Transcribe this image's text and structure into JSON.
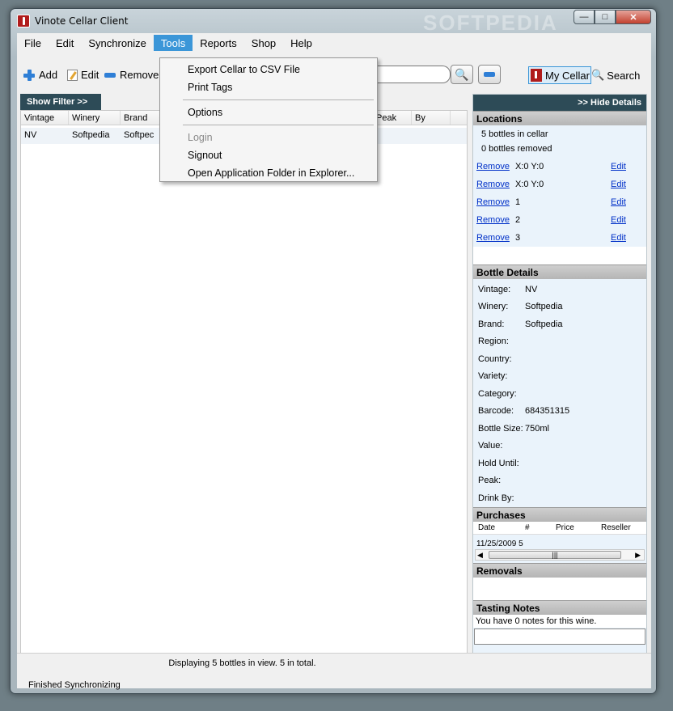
{
  "window": {
    "title": "Vinote Cellar Client",
    "watermark": "SOFTPEDIA"
  },
  "menu": {
    "file": "File",
    "edit": "Edit",
    "synchronize": "Synchronize",
    "tools": "Tools",
    "reports": "Reports",
    "shop": "Shop",
    "help": "Help"
  },
  "tools_menu": {
    "export": "Export Cellar to CSV File",
    "print": "Print Tags",
    "options": "Options",
    "login": "Login",
    "signout": "Signout",
    "open_folder": "Open Application Folder in Explorer..."
  },
  "toolbar": {
    "add": "Add",
    "edit": "Edit",
    "remove": "Remove",
    "my_cellar": "My Cellar",
    "search": "Search"
  },
  "filter": {
    "show": "Show Filter >>"
  },
  "table": {
    "columns": [
      "Vintage",
      "Winery",
      "Brand",
      "Peak",
      "By"
    ],
    "rows": [
      {
        "vintage": "NV",
        "winery": "Softpedia",
        "brand": "Softpec"
      }
    ]
  },
  "status": {
    "displaying": "Displaying 5 bottles in view. 5 in total.",
    "sync": "Finished Synchronizing"
  },
  "details": {
    "hide": ">> Hide Details",
    "locations_title": "Locations",
    "in_cellar": "5 bottles in cellar",
    "removed": "0 bottles removed",
    "remove_link": "Remove",
    "edit_link": "Edit",
    "locations": [
      "X:0 Y:0",
      "X:0 Y:0",
      "1",
      "2",
      "3"
    ],
    "bottle_title": "Bottle Details",
    "fields": [
      {
        "label": "Vintage:",
        "value": "NV"
      },
      {
        "label": "Winery:",
        "value": "Softpedia"
      },
      {
        "label": "Brand:",
        "value": "Softpedia"
      },
      {
        "label": "Region:",
        "value": ""
      },
      {
        "label": "Country:",
        "value": ""
      },
      {
        "label": "Variety:",
        "value": ""
      },
      {
        "label": "Category:",
        "value": ""
      },
      {
        "label": "Barcode:",
        "value": "684351315"
      },
      {
        "label": "Bottle Size:",
        "value": "750ml"
      },
      {
        "label": "Value:",
        "value": ""
      },
      {
        "label": "Hold Until:",
        "value": ""
      },
      {
        "label": "Peak:",
        "value": ""
      },
      {
        "label": "Drink By:",
        "value": ""
      }
    ],
    "purchases_title": "Purchases",
    "purchase_cols": [
      "Date",
      "#",
      "Price",
      "Reseller"
    ],
    "purchase_row": {
      "date": "11/25/2009",
      "qty": "5"
    },
    "removals_title": "Removals",
    "notes_title": "Tasting Notes",
    "notes_text": "You have 0 notes for this wine."
  }
}
